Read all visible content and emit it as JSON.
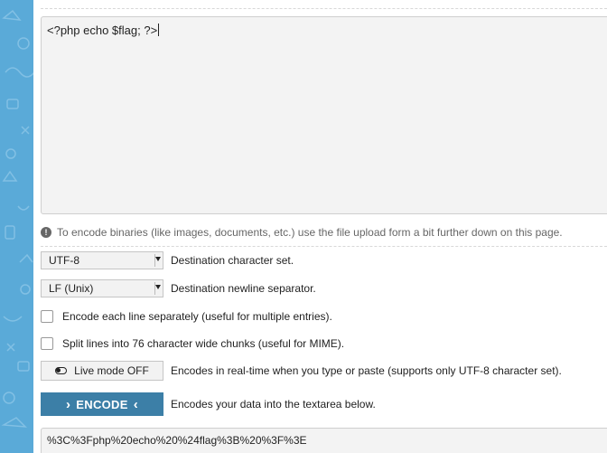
{
  "source": {
    "text": "<?php echo $flag; ?>"
  },
  "info": {
    "text": "To encode binaries (like images, documents, etc.) use the file upload form a bit further down on this page."
  },
  "options": {
    "charset": {
      "value": "UTF-8",
      "label": "Destination character set."
    },
    "newline": {
      "value": "LF (Unix)",
      "label": "Destination newline separator."
    },
    "each_line": {
      "label": "Encode each line separately (useful for multiple entries).",
      "checked": false
    },
    "split_lines": {
      "label": "Split lines into 76 character wide chunks (useful for MIME).",
      "checked": false
    },
    "live_mode": {
      "button_label": "Live mode OFF",
      "label": "Encodes in real-time when you type or paste (supports only UTF-8 character set)."
    },
    "encode": {
      "button_label": "ENCODE",
      "label": "Encodes your data into the textarea below."
    }
  },
  "result": {
    "text": "%3C%3Fphp%20echo%20%24flag%3B%20%3F%3E"
  },
  "colors": {
    "side_strip": "#5aaad8",
    "encode_button": "#3c7fa7"
  }
}
